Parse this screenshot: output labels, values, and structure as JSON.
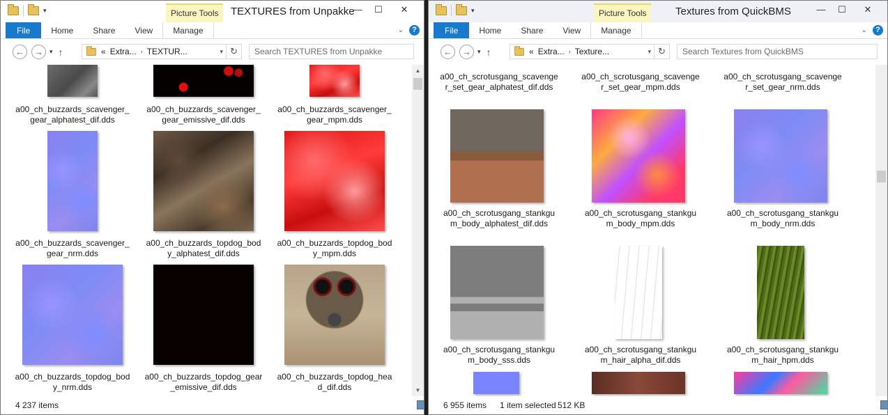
{
  "left": {
    "title": "TEXTURES from Unpakke",
    "context_tab": "Picture Tools",
    "ribbon_tabs": [
      "File",
      "Home",
      "Share",
      "View",
      "Manage"
    ],
    "address": {
      "chevron": "«",
      "segments": [
        "Extra...",
        "TEXTUR..."
      ]
    },
    "search_placeholder": "Search TEXTURES from Unpakke",
    "status": {
      "items": "4 237 items"
    },
    "files": [
      {
        "name": "a00_ch_buzzards_scavenger_gear_alphatest_dif.dds",
        "texture": "grey"
      },
      {
        "name": "a00_ch_buzzards_scavenger_gear_emissive_dif.dds",
        "texture": "blackred"
      },
      {
        "name": "a00_ch_buzzards_scavenger_gear_mpm.dds",
        "texture": "red"
      },
      {
        "name": "a00_ch_buzzards_scavenger_gear_nrm.dds",
        "texture": "normal"
      },
      {
        "name": "a00_ch_buzzards_topdog_body_alphatest_dif.dds",
        "texture": "leather"
      },
      {
        "name": "a00_ch_buzzards_topdog_body_mpm.dds",
        "texture": "red"
      },
      {
        "name": "a00_ch_buzzards_topdog_body_nrm.dds",
        "texture": "normal"
      },
      {
        "name": "a00_ch_buzzards_topdog_gear_emissive_dif.dds",
        "texture": "black"
      },
      {
        "name": "a00_ch_buzzards_topdog_head_dif.dds",
        "texture": "face"
      }
    ]
  },
  "right": {
    "title": "Textures from QuickBMS",
    "context_tab": "Picture Tools",
    "ribbon_tabs": [
      "File",
      "Home",
      "Share",
      "View",
      "Manage"
    ],
    "address": {
      "chevron": "«",
      "segments": [
        "Extra...",
        "Texture..."
      ]
    },
    "search_placeholder": "Search Textures from QuickBMS",
    "status": {
      "items": "6 955 items",
      "selected": "1 item selected",
      "size": "512 KB"
    },
    "files": [
      {
        "name": "a00_ch_scrotusgang_scavenger_set_gear_alphatest_dif.dds",
        "texture": "none"
      },
      {
        "name": "a00_ch_scrotusgang_scavenger_set_gear_mpm.dds",
        "texture": "none"
      },
      {
        "name": "a00_ch_scrotusgang_scavenger_set_gear_nrm.dds",
        "texture": "none"
      },
      {
        "name": "a00_ch_scrotusgang_stankgum_body_alphatest_dif.dds",
        "texture": "scav"
      },
      {
        "name": "a00_ch_scrotusgang_stankgum_body_mpm.dds",
        "texture": "pinkmpm"
      },
      {
        "name": "a00_ch_scrotusgang_stankgum_body_nrm.dds",
        "texture": "normal"
      },
      {
        "name": "a00_ch_scrotusgang_stankgum_body_sss.dds",
        "texture": "sss"
      },
      {
        "name": "a00_ch_scrotusgang_stankgum_hair_alpha_dif.dds",
        "texture": "hair"
      },
      {
        "name": "a00_ch_scrotusgang_stankgum_hair_hpm.dds",
        "texture": "green"
      }
    ]
  },
  "window_buttons": {
    "minimize": "—",
    "maximize": "☐",
    "close": "✕"
  },
  "colors": {
    "accent": "#1979ca",
    "context_tab": "#fbf6c0"
  }
}
